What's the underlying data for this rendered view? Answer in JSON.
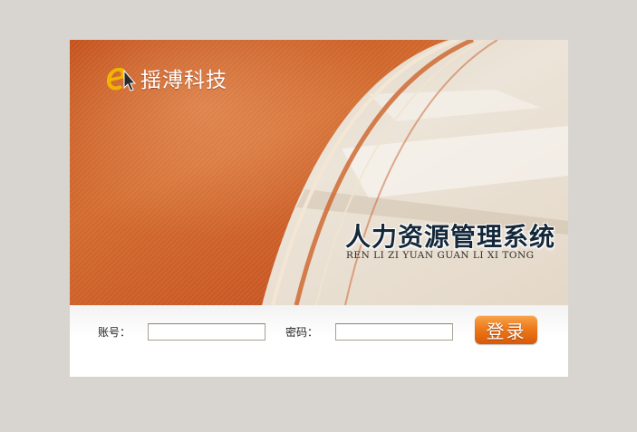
{
  "banner": {
    "company_name": "揺溥科技",
    "system_title": "人力资源管理系统",
    "system_subtitle": "REN LI ZI YUAN GUAN LI XI TONG",
    "logo_icon": "e-cursor-logo-icon"
  },
  "form": {
    "account_label": "账号：",
    "account_value": "",
    "password_label": "密码：",
    "password_value": "",
    "login_label": "登录"
  },
  "colors": {
    "page_background": "#d8d5d0",
    "banner_orange": "#c8561c",
    "banner_beige": "#e6dccd",
    "button_orange": "#ee7a1c"
  }
}
